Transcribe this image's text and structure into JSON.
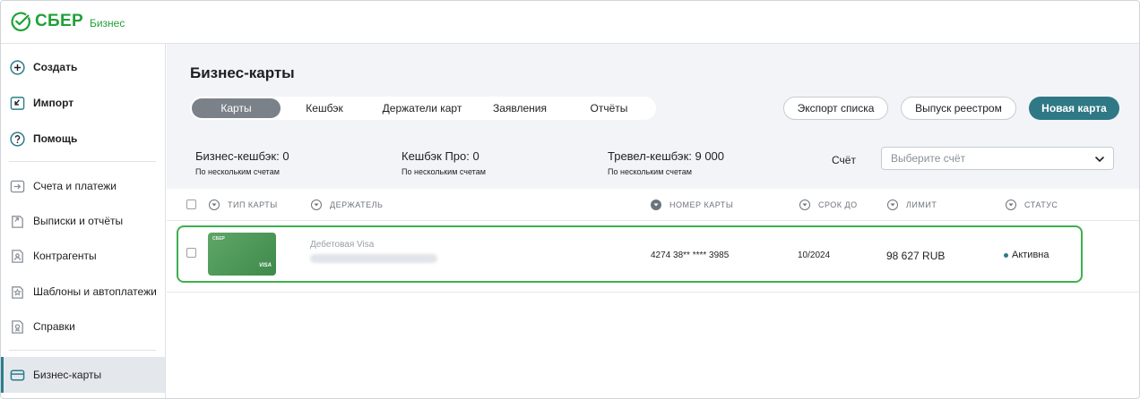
{
  "brand": {
    "name": "СБЕР",
    "sub": "Бизнес",
    "color": "#21a038"
  },
  "sidebar": {
    "items": [
      {
        "label": "Создать",
        "icon": "plus-circle-icon"
      },
      {
        "label": "Импорт",
        "icon": "import-icon"
      },
      {
        "label": "Помощь",
        "icon": "help-icon"
      },
      {
        "label": "Счета и платежи",
        "icon": "accounts-icon"
      },
      {
        "label": "Выписки и отчёты",
        "icon": "statements-icon"
      },
      {
        "label": "Контрагенты",
        "icon": "contractors-icon"
      },
      {
        "label": "Шаблоны и автоплатежи",
        "icon": "templates-icon"
      },
      {
        "label": "Справки",
        "icon": "certificates-icon"
      },
      {
        "label": "Бизнес-карты",
        "icon": "card-icon",
        "active": true
      }
    ]
  },
  "main": {
    "title": "Бизнес-карты",
    "tabs": [
      {
        "label": "Карты",
        "active": true
      },
      {
        "label": "Кешбэк"
      },
      {
        "label": "Держатели карт"
      },
      {
        "label": "Заявления"
      },
      {
        "label": "Отчёты"
      }
    ],
    "buttons": {
      "export": "Экспорт списка",
      "registry": "Выпуск реестром",
      "new_card": "Новая карта"
    },
    "stats": [
      {
        "value": "Бизнес-кешбэк: 0",
        "sub": "По нескольким счетам"
      },
      {
        "value": "Кешбэк Про: 0",
        "sub": "По нескольким счетам"
      },
      {
        "value": "Тревел-кешбэк: 9 000",
        "sub": "По нескольким счетам"
      }
    ],
    "account": {
      "label": "Счёт",
      "placeholder": "Выберите счёт"
    }
  },
  "table": {
    "columns": {
      "type": "ТИП КАРТЫ",
      "holder": "ДЕРЖАТЕЛЬ",
      "number": "НОМЕР КАРТЫ",
      "expiry": "СРОК ДО",
      "limit": "ЛИМИТ",
      "status": "СТАТУС"
    },
    "rows": [
      {
        "card_brand": "СБЕР",
        "network": "VISA",
        "card_type": "Дебетовая Visa",
        "number": "4274 38** **** 3985",
        "expiry": "10/2024",
        "limit": "98 627 RUB",
        "status": "Активна"
      }
    ]
  },
  "colors": {
    "accent": "#2f7886",
    "selected_row_border": "#3fae4f",
    "page_bg": "#f2f4f7"
  }
}
